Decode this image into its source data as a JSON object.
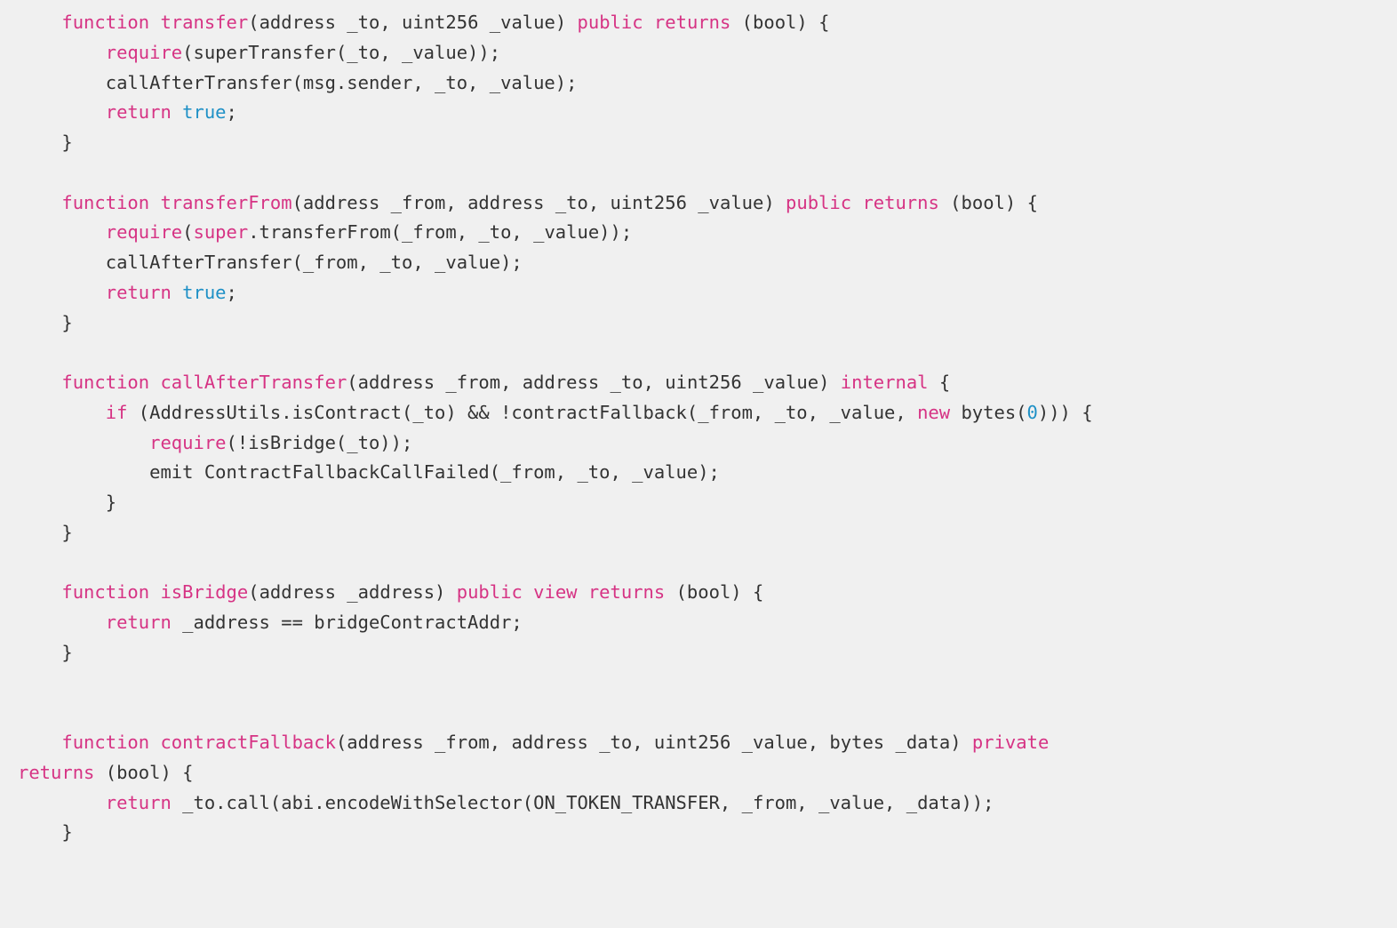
{
  "code": {
    "lines": [
      {
        "indent": "    ",
        "tokens": [
          {
            "t": "function ",
            "c": "kw"
          },
          {
            "t": "transfer",
            "c": "name"
          },
          {
            "t": "(",
            "c": ""
          },
          {
            "t": "address",
            "c": ""
          },
          {
            "t": " _to, ",
            "c": ""
          },
          {
            "t": "uint256",
            "c": ""
          },
          {
            "t": " _value) ",
            "c": ""
          },
          {
            "t": "public returns",
            "c": "kw"
          },
          {
            "t": " (",
            "c": ""
          },
          {
            "t": "bool",
            "c": ""
          },
          {
            "t": ") {",
            "c": ""
          }
        ]
      },
      {
        "indent": "        ",
        "tokens": [
          {
            "t": "require",
            "c": "kw"
          },
          {
            "t": "(superTransfer(_to, _value));",
            "c": ""
          }
        ]
      },
      {
        "indent": "        ",
        "tokens": [
          {
            "t": "callAfterTransfer(msg.sender, _to, _value);",
            "c": ""
          }
        ]
      },
      {
        "indent": "        ",
        "tokens": [
          {
            "t": "return ",
            "c": "kw"
          },
          {
            "t": "true",
            "c": "lit"
          },
          {
            "t": ";",
            "c": ""
          }
        ]
      },
      {
        "indent": "    ",
        "tokens": [
          {
            "t": "}",
            "c": ""
          }
        ]
      },
      {
        "indent": "",
        "tokens": []
      },
      {
        "indent": "    ",
        "tokens": [
          {
            "t": "function ",
            "c": "kw"
          },
          {
            "t": "transferFrom",
            "c": "name"
          },
          {
            "t": "(",
            "c": ""
          },
          {
            "t": "address",
            "c": ""
          },
          {
            "t": " _from, ",
            "c": ""
          },
          {
            "t": "address",
            "c": ""
          },
          {
            "t": " _to, ",
            "c": ""
          },
          {
            "t": "uint256",
            "c": ""
          },
          {
            "t": " _value) ",
            "c": ""
          },
          {
            "t": "public returns",
            "c": "kw"
          },
          {
            "t": " (",
            "c": ""
          },
          {
            "t": "bool",
            "c": ""
          },
          {
            "t": ") {",
            "c": ""
          }
        ]
      },
      {
        "indent": "        ",
        "tokens": [
          {
            "t": "require",
            "c": "kw"
          },
          {
            "t": "(",
            "c": ""
          },
          {
            "t": "super",
            "c": "kw"
          },
          {
            "t": ".transferFrom(_from, _to, _value));",
            "c": ""
          }
        ]
      },
      {
        "indent": "        ",
        "tokens": [
          {
            "t": "callAfterTransfer(_from, _to, _value);",
            "c": ""
          }
        ]
      },
      {
        "indent": "        ",
        "tokens": [
          {
            "t": "return ",
            "c": "kw"
          },
          {
            "t": "true",
            "c": "lit"
          },
          {
            "t": ";",
            "c": ""
          }
        ]
      },
      {
        "indent": "    ",
        "tokens": [
          {
            "t": "}",
            "c": ""
          }
        ]
      },
      {
        "indent": "",
        "tokens": []
      },
      {
        "indent": "    ",
        "tokens": [
          {
            "t": "function ",
            "c": "kw"
          },
          {
            "t": "callAfterTransfer",
            "c": "name"
          },
          {
            "t": "(",
            "c": ""
          },
          {
            "t": "address",
            "c": ""
          },
          {
            "t": " _from, ",
            "c": ""
          },
          {
            "t": "address",
            "c": ""
          },
          {
            "t": " _to, ",
            "c": ""
          },
          {
            "t": "uint256",
            "c": ""
          },
          {
            "t": " _value) ",
            "c": ""
          },
          {
            "t": "internal",
            "c": "kw"
          },
          {
            "t": " {",
            "c": ""
          }
        ]
      },
      {
        "indent": "        ",
        "tokens": [
          {
            "t": "if",
            "c": "kw"
          },
          {
            "t": " (AddressUtils.isContract(_to) && !contractFallback(_from, _to, _value, ",
            "c": ""
          },
          {
            "t": "new",
            "c": "kw"
          },
          {
            "t": " bytes(",
            "c": ""
          },
          {
            "t": "0",
            "c": "lit"
          },
          {
            "t": "))) {",
            "c": ""
          }
        ]
      },
      {
        "indent": "            ",
        "tokens": [
          {
            "t": "require",
            "c": "kw"
          },
          {
            "t": "(!isBridge(_to));",
            "c": ""
          }
        ]
      },
      {
        "indent": "            ",
        "tokens": [
          {
            "t": "emit ContractFallbackCallFailed(_from, _to, _value);",
            "c": ""
          }
        ]
      },
      {
        "indent": "        ",
        "tokens": [
          {
            "t": "}",
            "c": ""
          }
        ]
      },
      {
        "indent": "    ",
        "tokens": [
          {
            "t": "}",
            "c": ""
          }
        ]
      },
      {
        "indent": "",
        "tokens": []
      },
      {
        "indent": "    ",
        "tokens": [
          {
            "t": "function ",
            "c": "kw"
          },
          {
            "t": "isBridge",
            "c": "name"
          },
          {
            "t": "(",
            "c": ""
          },
          {
            "t": "address",
            "c": ""
          },
          {
            "t": " _address) ",
            "c": ""
          },
          {
            "t": "public view returns",
            "c": "kw"
          },
          {
            "t": " (",
            "c": ""
          },
          {
            "t": "bool",
            "c": ""
          },
          {
            "t": ") {",
            "c": ""
          }
        ]
      },
      {
        "indent": "        ",
        "tokens": [
          {
            "t": "return",
            "c": "kw"
          },
          {
            "t": " _address == bridgeContractAddr;",
            "c": ""
          }
        ]
      },
      {
        "indent": "    ",
        "tokens": [
          {
            "t": "}",
            "c": ""
          }
        ]
      },
      {
        "indent": "",
        "tokens": []
      },
      {
        "indent": "",
        "tokens": []
      },
      {
        "indent": "    ",
        "tokens": [
          {
            "t": "function ",
            "c": "kw"
          },
          {
            "t": "contractFallback",
            "c": "name"
          },
          {
            "t": "(",
            "c": ""
          },
          {
            "t": "address",
            "c": ""
          },
          {
            "t": " _from, ",
            "c": ""
          },
          {
            "t": "address",
            "c": ""
          },
          {
            "t": " _to, ",
            "c": ""
          },
          {
            "t": "uint256",
            "c": ""
          },
          {
            "t": " _value, ",
            "c": ""
          },
          {
            "t": "bytes",
            "c": ""
          },
          {
            "t": " _data) ",
            "c": ""
          },
          {
            "t": "private",
            "c": "kw"
          }
        ]
      },
      {
        "indent": "",
        "tokens": [
          {
            "t": "returns",
            "c": "kw"
          },
          {
            "t": " (",
            "c": ""
          },
          {
            "t": "bool",
            "c": ""
          },
          {
            "t": ") {",
            "c": ""
          }
        ]
      },
      {
        "indent": "        ",
        "tokens": [
          {
            "t": "return",
            "c": "kw"
          },
          {
            "t": " _to.call(abi.encodeWithSelector(ON_TOKEN_TRANSFER, _from, _value, _data));",
            "c": ""
          }
        ]
      },
      {
        "indent": "    ",
        "tokens": [
          {
            "t": "}",
            "c": ""
          }
        ]
      }
    ]
  },
  "colors": {
    "keyword": "#d63384",
    "name": "#d63384",
    "literal": "#1e90c6",
    "text": "#333333",
    "bg": "#f0f0f0"
  }
}
